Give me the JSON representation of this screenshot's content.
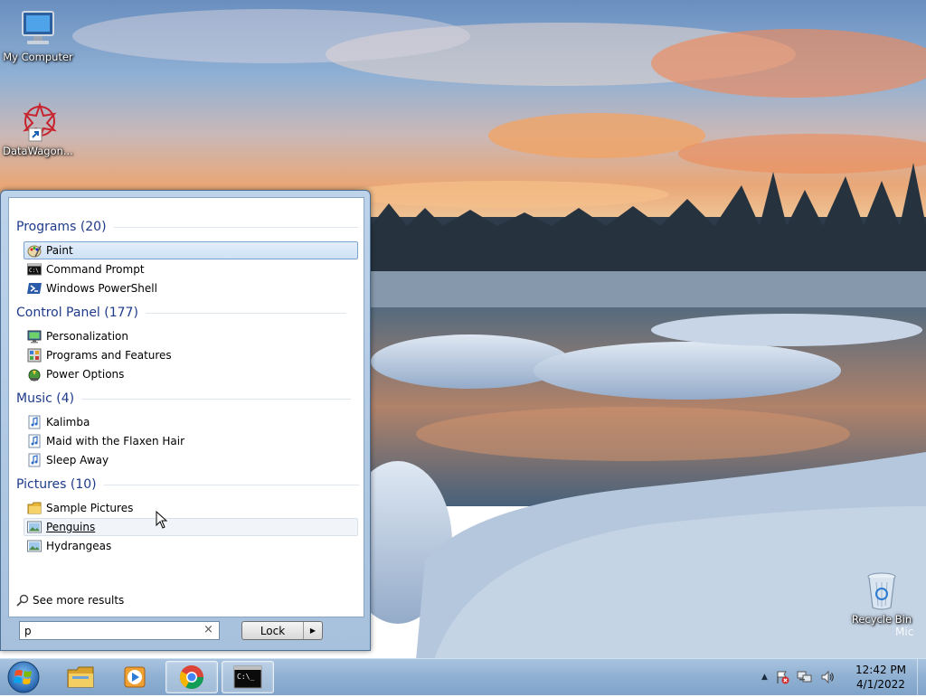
{
  "desktop": {
    "icons": [
      {
        "label": "My Computer",
        "icon": "computer-icon"
      },
      {
        "label": "DataWagon...",
        "icon": "datawagon-icon"
      },
      {
        "label": "Recycle Bin",
        "icon": "recycle-bin-icon"
      }
    ],
    "watermark": "Mic"
  },
  "start_menu": {
    "groups": [
      {
        "title": "Programs (20)",
        "items": [
          {
            "label": "Paint",
            "icon": "paint-icon",
            "state": "selected"
          },
          {
            "label": "Command Prompt",
            "icon": "cmd-icon"
          },
          {
            "label": "Windows PowerShell",
            "icon": "powershell-icon"
          }
        ]
      },
      {
        "title": "Control Panel (177)",
        "items": [
          {
            "label": "Personalization",
            "icon": "personalization-icon"
          },
          {
            "label": "Programs and Features",
            "icon": "programs-features-icon"
          },
          {
            "label": "Power Options",
            "icon": "power-options-icon"
          }
        ]
      },
      {
        "title": "Music (4)",
        "items": [
          {
            "label": "Kalimba",
            "icon": "music-file-icon"
          },
          {
            "label": "Maid with the Flaxen Hair",
            "icon": "music-file-icon"
          },
          {
            "label": "Sleep Away",
            "icon": "music-file-icon"
          }
        ]
      },
      {
        "title": "Pictures (10)",
        "items": [
          {
            "label": "Sample Pictures",
            "icon": "folder-icon"
          },
          {
            "label": "Penguins",
            "icon": "picture-file-icon",
            "state": "hover"
          },
          {
            "label": "Hydrangeas",
            "icon": "picture-file-icon"
          }
        ]
      }
    ],
    "see_more": "See more results",
    "search": {
      "value": "p",
      "clear": "×"
    },
    "lock": {
      "label": "Lock",
      "arrow": "▶"
    }
  },
  "taskbar": {
    "pinned": [
      {
        "name": "file-explorer",
        "icon": "folder-icon"
      },
      {
        "name": "media-player",
        "icon": "media-player-icon"
      },
      {
        "name": "chrome",
        "icon": "chrome-icon",
        "open": true
      },
      {
        "name": "command-prompt",
        "icon": "cmd-icon",
        "open": true
      }
    ],
    "tray": {
      "chevron": "▲"
    },
    "clock": {
      "time": "12:42 PM",
      "date": "4/1/2022"
    }
  },
  "colors": {
    "group_title": "#1e3a8a",
    "selection_border": "#7da2ce",
    "taskbar": "#8fb0d2"
  }
}
